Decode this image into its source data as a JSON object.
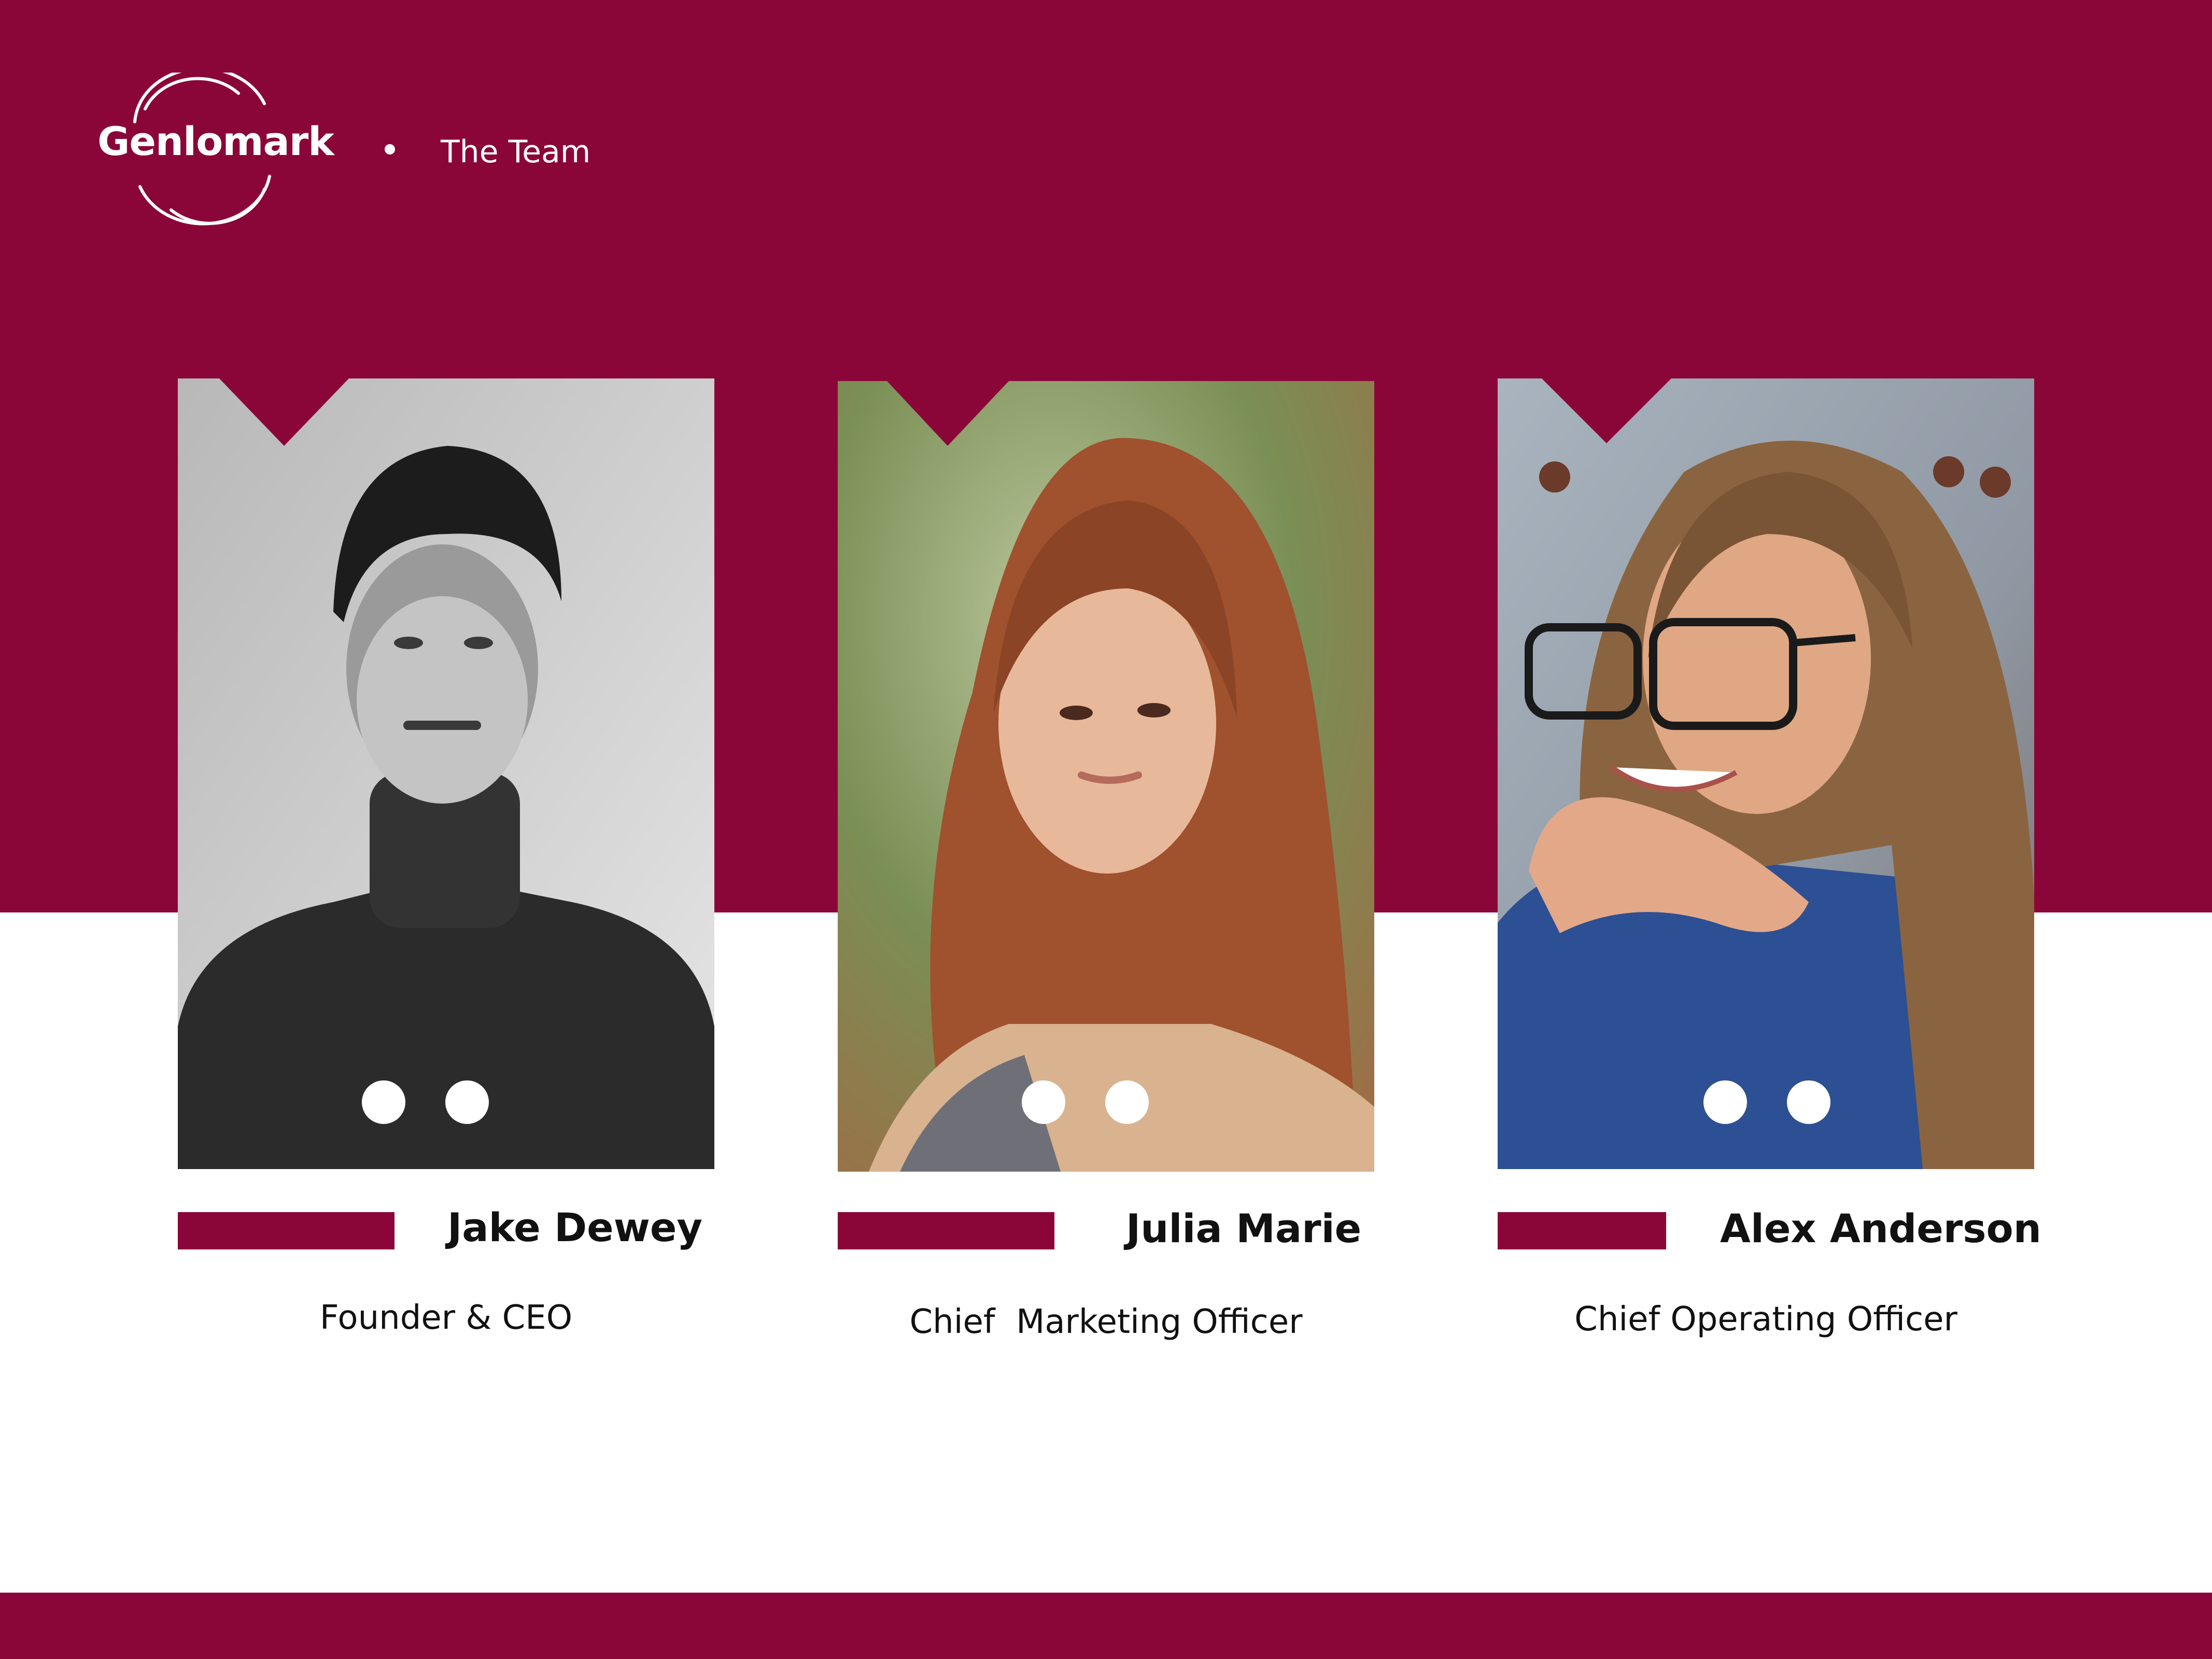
{
  "brand": {
    "name": "Genlomark",
    "color": "#8b0638"
  },
  "header": {
    "section_title": "The Team"
  },
  "team": [
    {
      "name": "Jake Dewey",
      "role": "Founder & CEO",
      "photo": "portrait-man-black-white"
    },
    {
      "name": "Julia Marie",
      "role": "Chief  Marketing Officer",
      "photo": "portrait-woman-red-hair"
    },
    {
      "name": "Alex Anderson",
      "role": "Chief Operating Officer",
      "photo": "portrait-woman-glasses"
    }
  ]
}
